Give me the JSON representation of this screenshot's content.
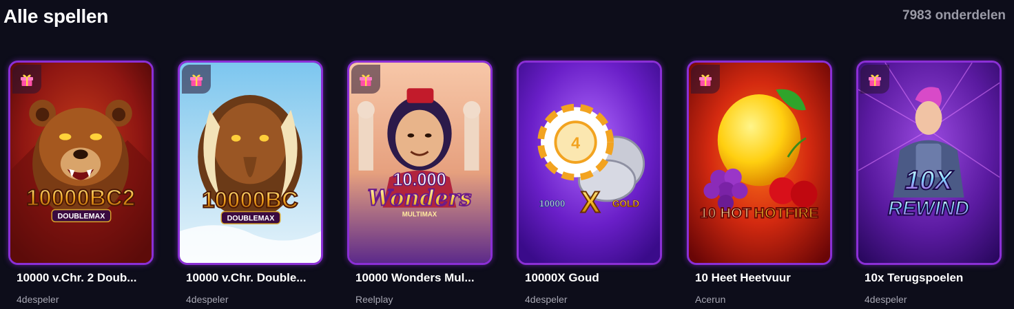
{
  "header": {
    "title": "Alle spellen",
    "count": "7983 onderdelen"
  },
  "games": [
    {
      "name": "10000 v.Chr. 2 Doub...",
      "provider": "4despeler",
      "art_title": "10000BC2",
      "art_sub": "DOUBLEMAX"
    },
    {
      "name": "10000 v.Chr. Double...",
      "provider": "4despeler",
      "art_title": "10000BC",
      "art_sub": "DOUBLEMAX"
    },
    {
      "name": "10000 Wonders Mul...",
      "provider": "Reelplay",
      "art_title": "10.000",
      "art_title2": "Wonders",
      "art_sub": "MULTIMAX"
    },
    {
      "name": "10000X Goud",
      "provider": "4despeler",
      "art_title": "10000",
      "art_title2": "X",
      "art_sub": "GOLD"
    },
    {
      "name": "10 Heet Heetvuur",
      "provider": "Acerun",
      "art_title": "10 HOT",
      "art_sub": "HOTFIRE"
    },
    {
      "name": "10x Terugspoelen",
      "provider": "4despeler",
      "art_title": "10X",
      "art_sub": "REWIND"
    }
  ],
  "colors": {
    "background": "#0d0d1a",
    "card_border": "#8b2fd6",
    "provider_text": "#a7a7b3"
  },
  "icons": {
    "card_badge": "gift-icon"
  }
}
